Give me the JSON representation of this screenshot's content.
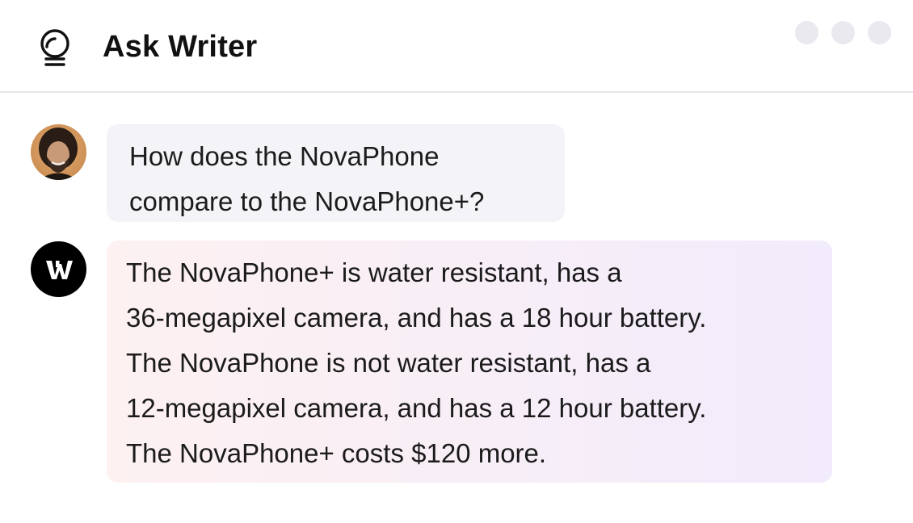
{
  "header": {
    "title": "Ask Writer",
    "logo_icon": "ask-bulb-icon",
    "menu_icon": "more-dots-icon"
  },
  "conversation": {
    "user_message": {
      "lines": [
        "How does the NovaPhone",
        "compare to the NovaPhone+?"
      ]
    },
    "assistant_message": {
      "avatar_letter": "W",
      "lines": [
        "The NovaPhone+ is water resistant, has a",
        "36-megapixel camera, and has a 18 hour battery.",
        "The NovaPhone is not water resistant, has a",
        "12-megapixel camera, and has a 12 hour battery.",
        "The NovaPhone+ costs $120 more."
      ]
    }
  },
  "colors": {
    "user_bubble": "#f3f3f8",
    "assistant_bubble_start": "#fdf1f1",
    "assistant_bubble_end": "#f1ebfb",
    "divider": "#e8e8ec",
    "dot": "#e9e9ef"
  }
}
